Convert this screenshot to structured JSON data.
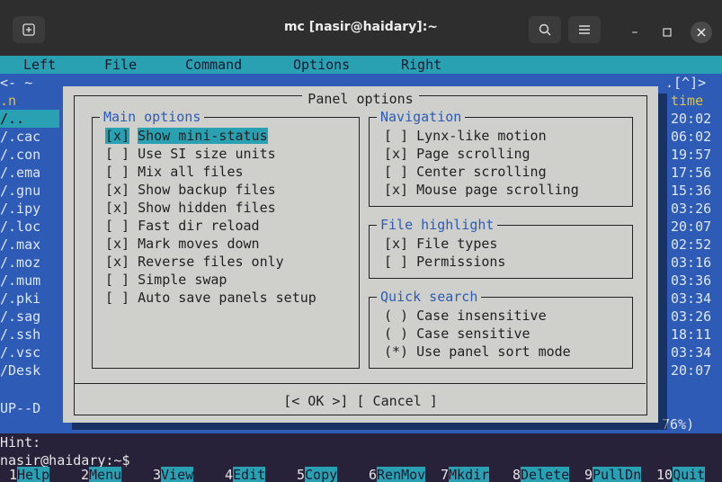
{
  "window": {
    "title": "mc [nasir@haidary]:~"
  },
  "menu": [
    "Left",
    "File",
    "Command",
    "Options",
    "Right"
  ],
  "left_panel": {
    "header": "<- ~",
    "files": [
      ".n",
      "/..",
      "/.cac",
      "/.con",
      "/.ema",
      "/.gnu",
      "/.ipy",
      "/.loc",
      "/.max",
      "/.moz",
      "/.mum",
      "/.pki",
      "/.sag",
      "/.ssh",
      "/.vsc",
      "/Desk"
    ],
    "status": "UP--D"
  },
  "right_panel": {
    "header": ".[^]>",
    "column_header": "time",
    "times": [
      "20:02",
      "06:02",
      "19:57",
      "17:56",
      "15:36",
      "03:26",
      "20:07",
      "02:52",
      "03:16",
      "03:36",
      "03:34",
      "03:26",
      "18:11",
      "03:34",
      "20:07"
    ],
    "footer": "76%)"
  },
  "dialog": {
    "title": "Panel options",
    "main_options": {
      "title": "Main options",
      "items": [
        {
          "box": "[x]",
          "label": "Show mini-status"
        },
        {
          "box": "[ ]",
          "label": "Use SI size units"
        },
        {
          "box": "[ ]",
          "label": "Mix all files"
        },
        {
          "box": "[x]",
          "label": "Show backup files"
        },
        {
          "box": "[x]",
          "label": "Show hidden files"
        },
        {
          "box": "[ ]",
          "label": "Fast dir reload"
        },
        {
          "box": "[x]",
          "label": "Mark moves down"
        },
        {
          "box": "[x]",
          "label": "Reverse files only"
        },
        {
          "box": "[ ]",
          "label": "Simple swap"
        },
        {
          "box": "[ ]",
          "label": "Auto save panels setup"
        }
      ]
    },
    "navigation": {
      "title": "Navigation",
      "items": [
        {
          "box": "[ ]",
          "label": "Lynx-like motion"
        },
        {
          "box": "[x]",
          "label": "Page scrolling"
        },
        {
          "box": "[ ]",
          "label": "Center scrolling"
        },
        {
          "box": "[x]",
          "label": "Mouse page scrolling"
        }
      ]
    },
    "file_highlight": {
      "title": "File highlight",
      "items": [
        {
          "box": "[x]",
          "label": "File types"
        },
        {
          "box": "[ ]",
          "label": "Permissions"
        }
      ]
    },
    "quick_search": {
      "title": "Quick search",
      "items": [
        {
          "box": "( )",
          "label": "Case insensitive"
        },
        {
          "box": "( )",
          "label": "Case sensitive"
        },
        {
          "box": "(*)",
          "label": "Use panel sort mode"
        }
      ]
    },
    "ok_button": "[< OK >]",
    "cancel_button": "[ Cancel ]"
  },
  "hint": "Hint:",
  "prompt": "nasir@haidary:~$",
  "fkeys": [
    {
      "num": "1",
      "label": "Help"
    },
    {
      "num": "2",
      "label": "Menu"
    },
    {
      "num": "3",
      "label": "View"
    },
    {
      "num": "4",
      "label": "Edit"
    },
    {
      "num": "5",
      "label": "Copy"
    },
    {
      "num": "6",
      "label": "RenMov"
    },
    {
      "num": "7",
      "label": "Mkdir"
    },
    {
      "num": "8",
      "label": "Delete"
    },
    {
      "num": "9",
      "label": "PullDn"
    },
    {
      "num": "10",
      "label": "Quit"
    }
  ]
}
